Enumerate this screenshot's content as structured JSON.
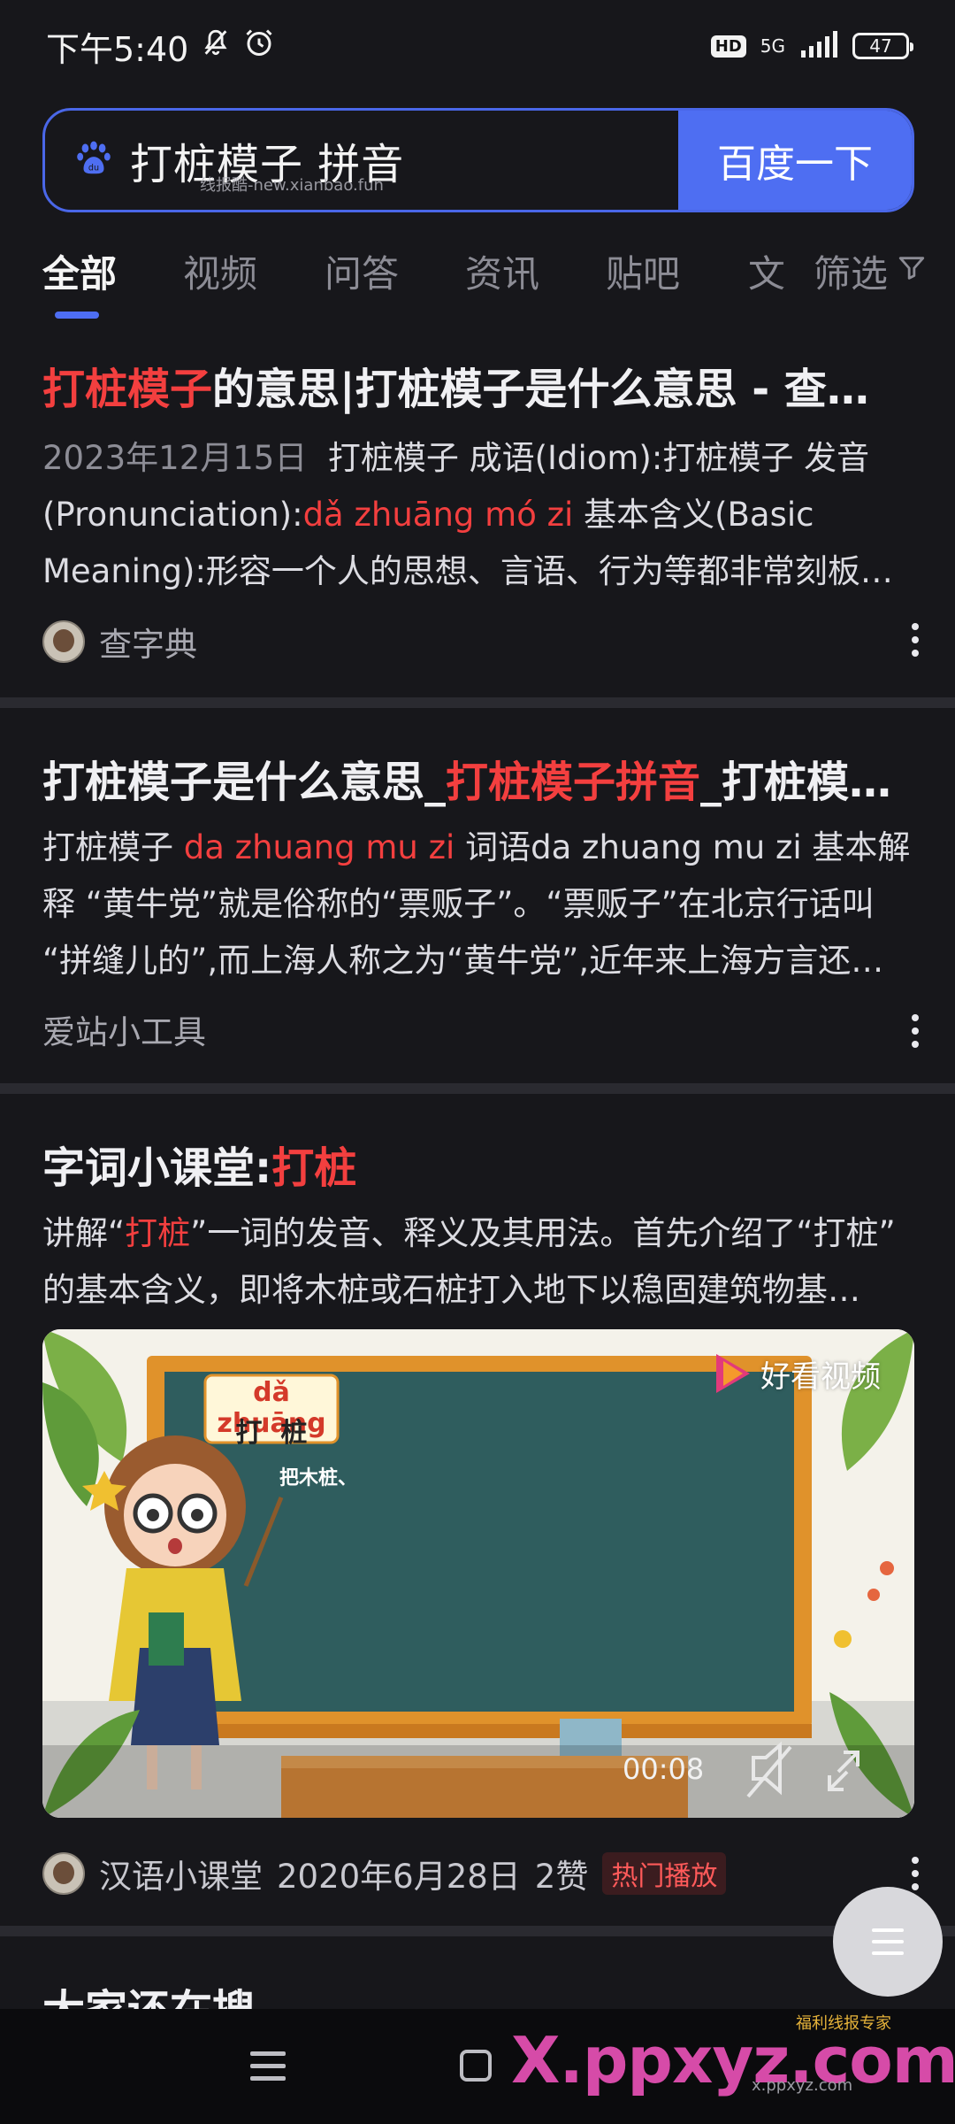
{
  "status_bar": {
    "time": "下午5:40",
    "network": "5G",
    "battery": "47",
    "hd": "HD"
  },
  "search": {
    "query": "打桩模子 拼音",
    "button_label": "百度一下",
    "watermark": "线报酷-new.xianbao.fun"
  },
  "tabs": {
    "items": [
      "全部",
      "视频",
      "问答",
      "资讯",
      "贴吧",
      "文"
    ],
    "filter_label": "筛选"
  },
  "results": [
    {
      "title_hl": "打桩模子",
      "title_rest": "的意思|打桩模子是什么意思 - 查…",
      "date": "2023年12月15日",
      "body_1": "打桩模子 成语(Idiom):打桩模子 发音",
      "body_2a": "(Pronunciation):",
      "body_2hl": "dǎ zhuāng mó zi",
      "body_2b": " 基本含义(Basic",
      "body_3": "Meaning):形容一个人的思想、言语、行为等都非常刻板…",
      "source": "查字典"
    },
    {
      "title_a": "打桩模子是什么意思_",
      "title_hl": "打桩模子拼音",
      "title_b": "_打桩模…",
      "body_1a": "打桩模子 ",
      "body_1hl": "da zhuang mu zi",
      "body_1b": " 词语da zhuang mu zi 基本解",
      "body_2": "释 “黄牛党”就是俗称的“票贩子”。“票贩子”在北京行话叫",
      "body_3": "“拼缝儿的”,而上海人称之为“黄牛党”,近年来上海方言还…",
      "source": "爱站小工具"
    },
    {
      "title_a": "字词小课堂:",
      "title_hl": "打桩",
      "body_1a": "讲解“",
      "body_1hl": "打桩",
      "body_1b": "”一词的发音、释义及其用法。首先介绍了“打桩”",
      "body_2": "的基本含义，即将木桩或石桩打入地下以稳固建筑物基…",
      "video": {
        "pinyin": "dǎ zhuāng",
        "chars": "打  桩",
        "board_text": "把木桩、",
        "brand": "好看视频",
        "duration": "00:08"
      },
      "source": "汉语小课堂",
      "date": "2020年6月28日",
      "likes": "2赞",
      "badge": "热门播放"
    }
  ],
  "next_section_title": "大家还在搜",
  "watermark": {
    "main": "X.ppxyz.com",
    "small": "福利线报专家",
    "url": "x.ppxyz.com"
  },
  "colors": {
    "accent": "#4e6ef2",
    "highlight": "#f33f3f",
    "background": "#17171b"
  }
}
